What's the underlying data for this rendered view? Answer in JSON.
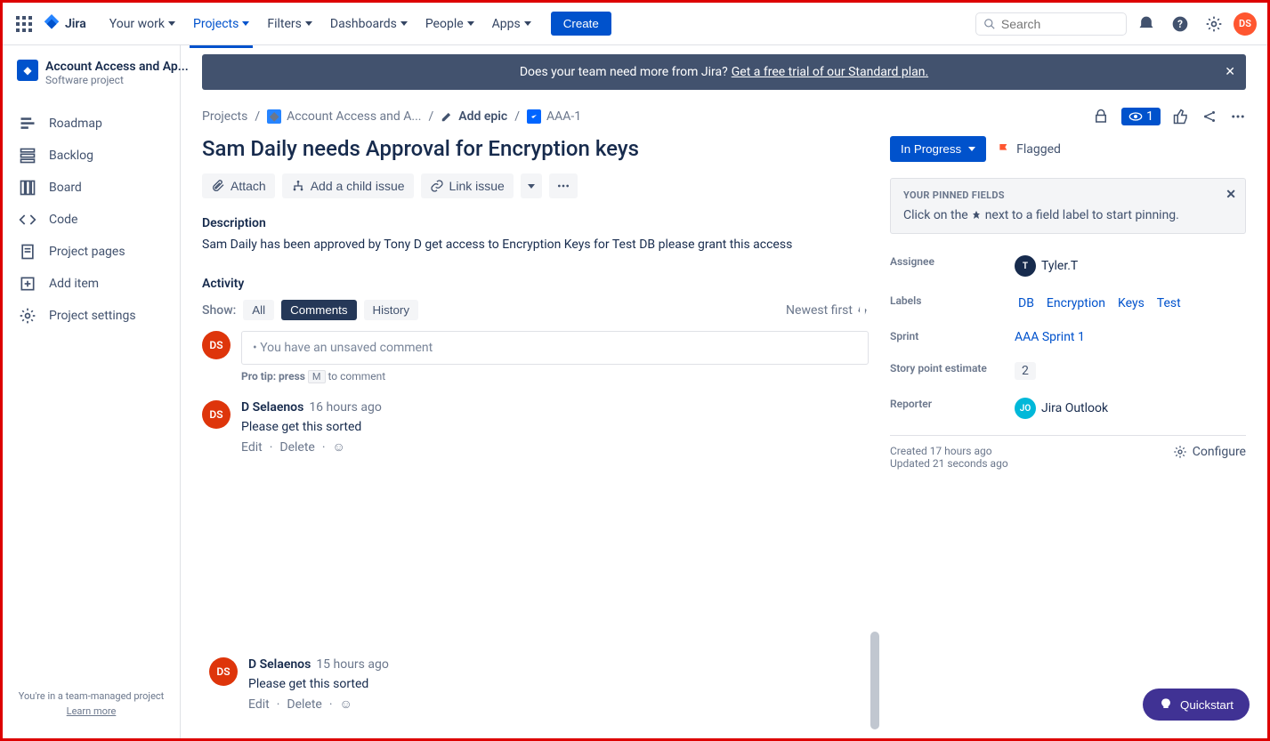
{
  "topnav": {
    "logo": "Jira",
    "items": [
      "Your work",
      "Projects",
      "Filters",
      "Dashboards",
      "People",
      "Apps"
    ],
    "create": "Create",
    "search_placeholder": "Search"
  },
  "user_avatar": "DS",
  "sidebar": {
    "project_name": "Account Access and Ap...",
    "project_type": "Software project",
    "items": [
      {
        "label": "Roadmap"
      },
      {
        "label": "Backlog"
      },
      {
        "label": "Board"
      },
      {
        "label": "Code"
      },
      {
        "label": "Project pages"
      },
      {
        "label": "Add item"
      },
      {
        "label": "Project settings"
      }
    ],
    "footer_line1": "You're in a team-managed project",
    "footer_link": "Learn more"
  },
  "banner": {
    "text": "Does your team need more from Jira?",
    "link": "Get a free trial of our Standard plan."
  },
  "breadcrumbs": {
    "projects": "Projects",
    "project": "Account Access and A...",
    "add_epic": "Add epic",
    "issue_key": "AAA-1"
  },
  "watch_count": "1",
  "issue": {
    "title": "Sam Daily needs Approval for Encryption keys",
    "actions": {
      "attach": "Attach",
      "child": "Add a child issue",
      "link": "Link issue"
    },
    "description_label": "Description",
    "description": "Sam Daily has been approved by Tony D  get access to Encryption Keys for Test DB please grant this access"
  },
  "activity": {
    "heading": "Activity",
    "show_label": "Show:",
    "tabs": {
      "all": "All",
      "comments": "Comments",
      "history": "History"
    },
    "sort": "Newest first",
    "comment_placeholder": "• You have an unsaved comment",
    "pro_tip_pre": "Pro tip: press",
    "pro_tip_key": "M",
    "pro_tip_post": "to comment",
    "comments": [
      {
        "avatar": "DS",
        "author": "D Selaenos",
        "time": "16 hours ago",
        "text": "Please get this sorted",
        "edit": "Edit",
        "delete": "Delete"
      },
      {
        "avatar": "DS",
        "author": "D Selaenos",
        "time": "15 hours ago",
        "text": "Please get this sorted",
        "edit": "Edit",
        "delete": "Delete"
      }
    ]
  },
  "details": {
    "status": "In Progress",
    "flagged": "Flagged",
    "pinned_title": "YOUR PINNED FIELDS",
    "pinned_hint_pre": "Click on the",
    "pinned_hint_post": "next to a field label to start pinning.",
    "fields": {
      "assignee_label": "Assignee",
      "assignee_value": "Tyler.T",
      "assignee_initial": "T",
      "labels_label": "Labels",
      "labels": [
        "DB",
        "Encryption",
        "Keys",
        "Test"
      ],
      "sprint_label": "Sprint",
      "sprint_value": "AAA Sprint 1",
      "story_label": "Story point estimate",
      "story_value": "2",
      "reporter_label": "Reporter",
      "reporter_value": "Jira Outlook",
      "reporter_initial": "JO"
    },
    "created": "Created 17 hours ago",
    "updated": "Updated 21 seconds ago",
    "configure": "Configure"
  },
  "quickstart": "Quickstart"
}
